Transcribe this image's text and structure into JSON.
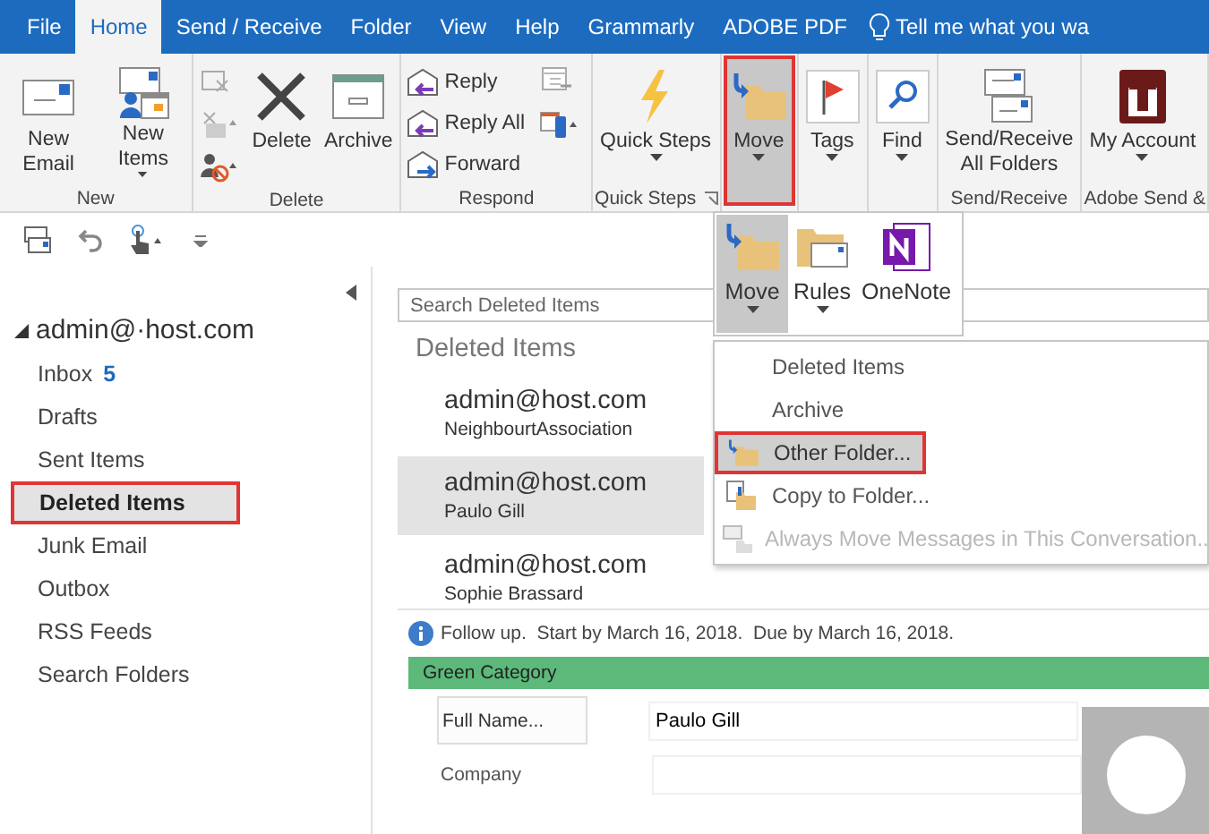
{
  "tabs": [
    {
      "label": "File",
      "selected": false
    },
    {
      "label": "Home",
      "selected": true
    },
    {
      "label": "Send / Receive",
      "selected": false
    },
    {
      "label": "Folder",
      "selected": false
    },
    {
      "label": "View",
      "selected": false
    },
    {
      "label": "Help",
      "selected": false
    },
    {
      "label": "Grammarly",
      "selected": false
    },
    {
      "label": "ADOBE PDF",
      "selected": false
    }
  ],
  "tell_me": "Tell me what you wa",
  "ribbon": {
    "groups": [
      {
        "label": "New",
        "buttons": [
          {
            "label": "New Email",
            "kind": "large",
            "dropdown": false,
            "selected": false,
            "outlined": false
          },
          {
            "label": "New Items",
            "kind": "large",
            "dropdown": true,
            "selected": false,
            "outlined": false
          }
        ]
      },
      {
        "label": "Delete",
        "buttons": [
          {
            "label": "Delete",
            "kind": "large",
            "dropdown": false,
            "selected": false,
            "outlined": false
          },
          {
            "label": "Archive",
            "kind": "large",
            "dropdown": false,
            "selected": false,
            "outlined": false
          }
        ]
      },
      {
        "label": "Respond",
        "buttons": [
          {
            "label": "Reply",
            "kind": "small",
            "dropdown": false,
            "selected": false,
            "outlined": false
          },
          {
            "label": "Reply All",
            "kind": "small",
            "dropdown": false,
            "selected": false,
            "outlined": false
          },
          {
            "label": "Forward",
            "kind": "small",
            "dropdown": false,
            "selected": false,
            "outlined": false
          }
        ]
      },
      {
        "label": "Quick Steps",
        "buttons": [
          {
            "label": "Quick Steps",
            "kind": "large",
            "dropdown": true,
            "selected": false,
            "outlined": false
          }
        ]
      },
      {
        "buttons": [
          {
            "label": "Move",
            "kind": "large",
            "dropdown": true,
            "selected": true,
            "outlined": true
          }
        ]
      },
      {
        "buttons": [
          {
            "label": "Tags",
            "kind": "large",
            "dropdown": true,
            "selected": false,
            "outlined": false
          }
        ]
      },
      {
        "buttons": [
          {
            "label": "Find",
            "kind": "large",
            "dropdown": true,
            "selected": false,
            "outlined": false
          }
        ]
      },
      {
        "label": "Send/Receive",
        "buttons": [
          {
            "label": "Send/Receive All Folders",
            "kind": "large",
            "dropdown": false,
            "selected": false,
            "outlined": false
          }
        ]
      },
      {
        "label": "Adobe Send &",
        "buttons": [
          {
            "label": "My Account",
            "kind": "large",
            "dropdown": true,
            "selected": false,
            "outlined": false
          }
        ]
      }
    ]
  },
  "folder_pane": {
    "account": "admin@·host.com",
    "expanded": true,
    "folders": [
      {
        "label": "Inbox",
        "count": "5",
        "selected": false,
        "outlined": false
      },
      {
        "label": "Drafts",
        "selected": false,
        "outlined": false
      },
      {
        "label": "Sent Items",
        "selected": false,
        "outlined": false
      },
      {
        "label": "Deleted Items",
        "selected": true,
        "outlined": true
      },
      {
        "label": "Junk Email",
        "selected": false,
        "outlined": false
      },
      {
        "label": "Outbox",
        "selected": false,
        "outlined": false
      },
      {
        "label": "RSS Feeds",
        "selected": false,
        "outlined": false
      },
      {
        "label": "Search Folders",
        "selected": false,
        "outlined": false
      }
    ]
  },
  "message_list": {
    "search": {
      "placeholder": "Search Deleted Items"
    },
    "heading": "Deleted Items",
    "messages": [
      {
        "sender": "admin@host.com",
        "subject": "NeighbourtAssociation",
        "selected": false
      },
      {
        "sender": "admin@host.com",
        "subject": "Paulo Gill",
        "selected": true
      },
      {
        "sender": "admin@host.com",
        "subject": "Sophie Brassard",
        "selected": false
      }
    ]
  },
  "move_dropdown": {
    "gallery": [
      {
        "label": "Move",
        "dropdown": true,
        "selected": true
      },
      {
        "label": "Rules",
        "dropdown": true,
        "selected": false
      },
      {
        "label": "OneNote",
        "dropdown": false,
        "selected": false
      }
    ],
    "menu": [
      {
        "label": "Deleted Items",
        "selected": false,
        "outlined": false,
        "disabled": false
      },
      {
        "label": "Archive",
        "selected": false,
        "outlined": false,
        "disabled": false
      },
      {
        "label": "Other Folder...",
        "selected": true,
        "outlined": true,
        "disabled": false
      },
      {
        "label": "Copy to Folder...",
        "selected": false,
        "outlined": false,
        "disabled": false
      },
      {
        "label": "Always Move Messages in This Conversation...",
        "selected": false,
        "outlined": false,
        "disabled": true
      }
    ]
  },
  "reading_pane": {
    "info": "Follow up.  Start by March 16, 2018.  Due by March 16, 2018.",
    "category": "Green Category",
    "fields": [
      {
        "label": "Full Name...",
        "kind": "button",
        "value": "Paulo Gill"
      },
      {
        "label": "Company",
        "kind": "label"
      }
    ]
  }
}
